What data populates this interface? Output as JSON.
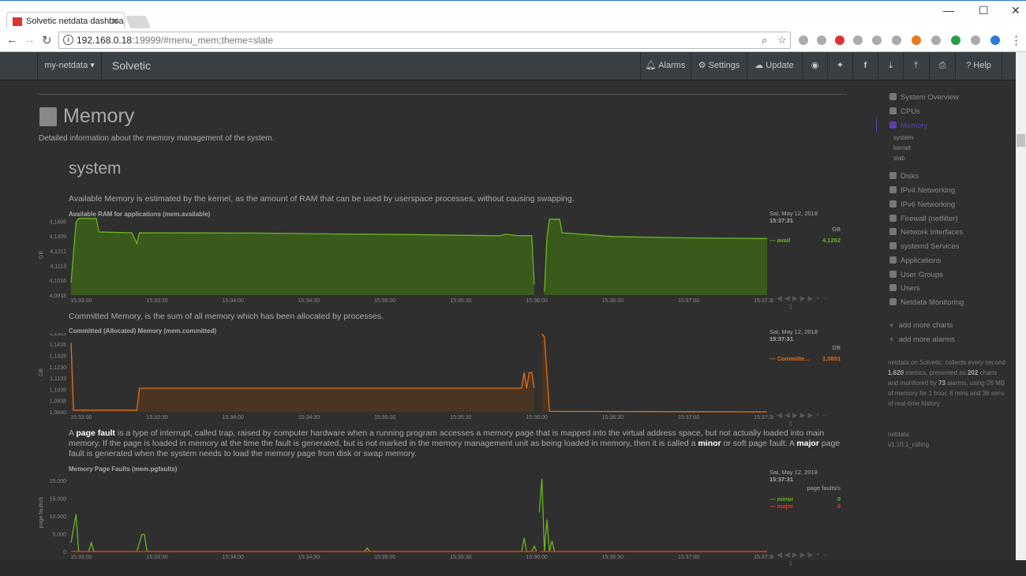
{
  "browser": {
    "tab_title": "Solvetic netdata dashboa",
    "url_host": "192.168.0.18",
    "url_path": ":19999/#menu_mem;theme=slate"
  },
  "navbar": {
    "host_menu": "my-netdata ▾",
    "brand": "Solvetic",
    "alarms": "Alarms",
    "settings": "Settings",
    "update": "Update",
    "help": "Help"
  },
  "page": {
    "title": "Memory",
    "subtitle": "Detailed information about the memory management of the system.",
    "section": "system",
    "desc1": "Available Memory is estimated by the kernel, as the amount of RAM that can be used by userspace processes, without causing swapping.",
    "desc2": "Committed Memory, is the sum of all memory which has been allocated by processes.",
    "desc3_parts": [
      "A ",
      "page fault",
      " is a type of interrupt, called trap, raised by computer hardware when a running program accesses a memory page that is mapped into the virtual address space, but not actually loaded into main memory. If the page is loaded in memory at the time the fault is generated, but is not marked in the memory management unit as being loaded in memory, then it is called a ",
      "minor",
      " or soft page fault. A ",
      "major",
      " page fault is generated when the system needs to load the memory page from disk or swap memory."
    ]
  },
  "legend": {
    "date": "Sat, May 12, 2018",
    "time": "15:37:31"
  },
  "chart_data": [
    {
      "type": "area",
      "title": "Available RAM for applications (mem.available)",
      "ylabel": "GB",
      "units": "GB",
      "ylim": [
        4.0918,
        4.145
      ],
      "yticks": [
        "4,0918",
        "4,1016",
        "4,1113",
        "4,1211",
        "4,1309",
        "4,1406"
      ],
      "ytick_values": [
        4.0918,
        4.1016,
        4.1113,
        4.1211,
        4.1309,
        4.1406
      ],
      "xticks": [
        "15:33:00",
        "15:33:30",
        "15:34:00",
        "15:34:30",
        "15:35:00",
        "15:35:30",
        "15:36:00",
        "15:36:30",
        "15:37:00",
        "15:37:30"
      ],
      "series": [
        {
          "name": "avail",
          "color": "#6ab522",
          "fill": "#3a5a1c",
          "value": "4,1292",
          "points": [
            [
              "15:32:56",
              4.1
            ],
            [
              "15:32:58",
              4.14
            ],
            [
              "15:32:59",
              4.1425
            ],
            [
              "15:33:06",
              4.1425
            ],
            [
              "15:33:07",
              4.1335
            ],
            [
              "15:33:20",
              4.133
            ],
            [
              "15:33:22",
              4.126
            ],
            [
              "15:33:23",
              4.133
            ],
            [
              "15:34:10",
              4.1328
            ],
            [
              "15:34:40",
              4.1322
            ],
            [
              "15:35:10",
              4.1318
            ],
            [
              "15:35:45",
              4.131
            ],
            [
              "15:35:48",
              4.132
            ],
            [
              "15:35:52",
              4.1312
            ],
            [
              "15:35:58",
              4.131
            ],
            [
              "15:35:59",
              4.099
            ],
            null,
            [
              "15:36:03",
              4.094
            ],
            [
              "15:36:04",
              4.13
            ],
            [
              "15:36:05",
              4.142
            ],
            [
              "15:36:09",
              4.142
            ],
            [
              "15:36:10",
              4.133
            ],
            [
              "15:36:30",
              4.1305
            ],
            [
              "15:37:00",
              4.1296
            ],
            [
              "15:37:31",
              4.1292
            ]
          ]
        }
      ]
    },
    {
      "type": "area",
      "title": "Committed (Allocated) Memory (mem.committed)",
      "ylabel": "GB",
      "units": "GB",
      "ylim": [
        1.084,
        1.1523
      ],
      "yticks": [
        "1,0840",
        "1,0938",
        "1,1035",
        "1,1133",
        "1,1230",
        "1,1328",
        "1,1426",
        "1,1523"
      ],
      "ytick_values": [
        1.084,
        1.0938,
        1.1035,
        1.1133,
        1.123,
        1.1328,
        1.1426,
        1.1523
      ],
      "xticks": [
        "15:33:00",
        "15:33:30",
        "15:34:00",
        "15:34:30",
        "15:35:00",
        "15:35:30",
        "15:36:00",
        "15:36:30",
        "15:37:00",
        "15:37:30"
      ],
      "series": [
        {
          "name": "Committe...",
          "color": "#e0701a",
          "fill": "#4a3422",
          "value": "1,0831",
          "points": [
            [
              "15:32:56",
              1.144
            ],
            [
              "15:32:57",
              1.0855
            ],
            [
              "15:33:22",
              1.0855
            ],
            [
              "15:33:23",
              1.1045
            ],
            [
              "15:35:54",
              1.1045
            ],
            [
              "15:35:55",
              1.118
            ],
            [
              "15:35:56",
              1.1045
            ],
            [
              "15:35:57",
              1.118
            ],
            [
              "15:35:58",
              1.118
            ],
            [
              "15:35:59",
              1.1045
            ],
            null,
            [
              "15:36:02",
              1.1515
            ],
            [
              "15:36:03",
              1.149
            ],
            [
              "15:36:05",
              1.0845
            ],
            [
              "15:37:31",
              1.084
            ]
          ]
        }
      ]
    },
    {
      "type": "line",
      "title": "Memory Page Faults (mem.pgfaults)",
      "ylabel": "page faults/s",
      "units": "page faults/s",
      "ylim": [
        0,
        22000
      ],
      "yticks": [
        "0",
        "5.000",
        "10.000",
        "15.000",
        "20.000"
      ],
      "ytick_values": [
        0,
        5000,
        10000,
        15000,
        20000
      ],
      "xticks": [
        "15:33:00",
        "15:33:30",
        "15:34:00",
        "15:34:30",
        "15:35:00",
        "15:35:30",
        "15:36:00",
        "15:36:30",
        "15:37:00",
        "15:37:30"
      ],
      "series": [
        {
          "name": "minor",
          "color": "#6ab522",
          "value": "0",
          "points": [
            [
              "15:32:56",
              2500
            ],
            [
              "15:32:58",
              10500
            ],
            [
              "15:32:59",
              0
            ],
            [
              "15:33:03",
              0
            ],
            [
              "15:33:04",
              2500
            ],
            [
              "15:33:05",
              0
            ],
            [
              "15:33:22",
              0
            ],
            [
              "15:33:24",
              4800
            ],
            [
              "15:33:25",
              4800
            ],
            [
              "15:33:26",
              0
            ],
            [
              "15:34:52",
              0
            ],
            [
              "15:34:53",
              1000
            ],
            [
              "15:34:54",
              0
            ],
            [
              "15:35:54",
              0
            ],
            [
              "15:35:55",
              3800
            ],
            [
              "15:35:56",
              0
            ],
            [
              "15:35:58",
              0
            ],
            [
              "15:35:59",
              1500
            ],
            [
              "15:36:00",
              0
            ],
            null,
            [
              "15:36:01",
              11000
            ],
            [
              "15:36:02",
              20500
            ],
            [
              "15:36:03",
              0
            ],
            [
              "15:36:04",
              9000
            ],
            [
              "15:36:05",
              0
            ],
            [
              "15:36:06",
              3000
            ],
            [
              "15:36:07",
              0
            ],
            [
              "15:37:31",
              0
            ]
          ]
        },
        {
          "name": "major",
          "color": "#e03c1a",
          "value": "0",
          "points": [
            [
              "15:32:56",
              0
            ],
            [
              "15:36:00",
              0
            ],
            null,
            [
              "15:36:01",
              0
            ],
            [
              "15:37:31",
              0
            ]
          ]
        }
      ]
    }
  ],
  "sidebar": {
    "items": [
      "System Overview",
      "CPUs",
      "Memory",
      "Disks",
      "IPv4 Networking",
      "IPv6 Networking",
      "Firewall (netfilter)",
      "Network Interfaces",
      "systemd Services",
      "Applications",
      "User Groups",
      "Users",
      "Netdata Monitoring"
    ],
    "subitems": [
      "system",
      "kernel",
      "slab"
    ],
    "add_charts": "add more charts",
    "add_alarms": "add more alarms",
    "info_parts": [
      "netdata on Solvetic, collects every second ",
      "1.620",
      " metrics, presented as ",
      "202",
      " charts and monitored by ",
      "73",
      " alarms, using 26 MB of memory for 1 hour, 6 mins and 36 secs of real-time history"
    ],
    "version_label": "netdata",
    "version": "v1.10.1_rolling",
    "active_color": "#5a3fb0"
  }
}
